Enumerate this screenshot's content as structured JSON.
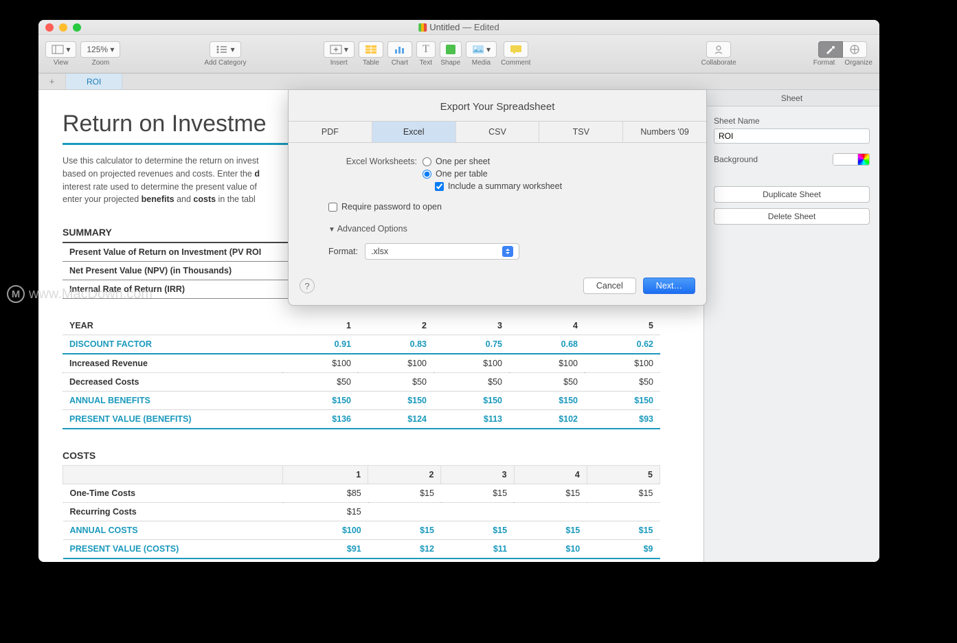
{
  "window": {
    "title_strong": "Untitled",
    "title_suffix": " — Edited"
  },
  "toolbar": {
    "zoom_value": "125%",
    "view": "View",
    "zoom": "Zoom",
    "add_category": "Add Category",
    "insert": "Insert",
    "table": "Table",
    "chart": "Chart",
    "text": "Text",
    "shape": "Shape",
    "media": "Media",
    "comment": "Comment",
    "collaborate": "Collaborate",
    "format": "Format",
    "organize": "Organize"
  },
  "tabs": {
    "roi": "ROI"
  },
  "doc": {
    "title": "Return on Investme",
    "desc_1": "Use this calculator to determine the return on invest",
    "desc_2": "based on projected revenues and costs. Enter the ",
    "desc_bold_1": "d",
    "desc_3": "interest rate used to determine the present value of ",
    "desc_4": "enter your projected ",
    "desc_bold_2": "benefits",
    "desc_5": " and ",
    "desc_bold_3": "costs",
    "desc_6": " in the tabl",
    "summary_heading": "SUMMARY",
    "summary_rows": [
      "Present Value of Return on Investment (PV ROI",
      "Net Present Value (NPV) (in Thousands)",
      "Internal Rate of Return (IRR)"
    ],
    "year_heading": "YEAR",
    "discount_heading": "DISCOUNT FACTOR",
    "years": [
      "1",
      "2",
      "3",
      "4",
      "5"
    ],
    "discount": [
      "0.91",
      "0.83",
      "0.75",
      "0.68",
      "0.62"
    ],
    "inc_rev": {
      "label": "Increased Revenue",
      "vals": [
        "$100",
        "$100",
        "$100",
        "$100",
        "$100"
      ]
    },
    "dec_cost": {
      "label": "Decreased Costs",
      "vals": [
        "$50",
        "$50",
        "$50",
        "$50",
        "$50"
      ]
    },
    "ann_ben": {
      "label": "ANNUAL BENEFITS",
      "vals": [
        "$150",
        "$150",
        "$150",
        "$150",
        "$150"
      ]
    },
    "pv_ben": {
      "label": "PRESENT VALUE (BENEFITS)",
      "vals": [
        "$136",
        "$124",
        "$113",
        "$102",
        "$93"
      ]
    },
    "costs_heading": "COSTS",
    "one_time": {
      "label": "One-Time Costs",
      "vals": [
        "$85",
        "$15",
        "$15",
        "$15",
        "$15"
      ]
    },
    "recurring": {
      "label": "Recurring Costs",
      "vals": [
        "$15",
        "",
        "",
        "",
        ""
      ]
    },
    "ann_cost": {
      "label": "ANNUAL COSTS",
      "vals": [
        "$100",
        "$15",
        "$15",
        "$15",
        "$15"
      ]
    },
    "pv_cost": {
      "label": "PRESENT VALUE (COSTS)",
      "vals": [
        "$91",
        "$12",
        "$11",
        "$10",
        "$9"
      ]
    }
  },
  "modal": {
    "title": "Export Your Spreadsheet",
    "tabs": [
      "PDF",
      "Excel",
      "CSV",
      "TSV",
      "Numbers '09"
    ],
    "worksheets_label": "Excel Worksheets:",
    "opt_sheet": "One per sheet",
    "opt_table": "One per table",
    "opt_summary": "Include a summary worksheet",
    "req_pass": "Require password to open",
    "advanced": "Advanced Options",
    "format_label": "Format:",
    "format_value": ".xlsx",
    "help": "?",
    "cancel": "Cancel",
    "next": "Next…"
  },
  "inspector": {
    "header": "Sheet",
    "name_label": "Sheet Name",
    "name_value": "ROI",
    "background_label": "Background",
    "duplicate": "Duplicate Sheet",
    "delete": "Delete Sheet"
  },
  "watermark": "www.MacDown.com"
}
